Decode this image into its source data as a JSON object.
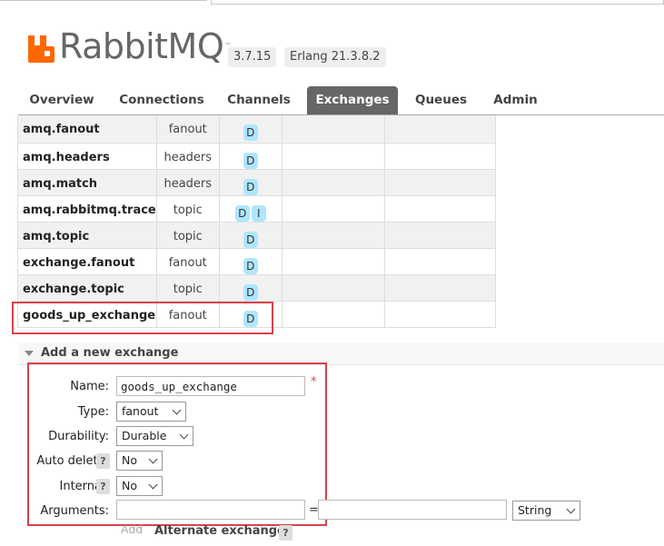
{
  "app": {
    "logo_text": "RabbitMQ",
    "version": "3.7.15",
    "erlang": "Erlang 21.3.8.2",
    "brand_color": "#ff6600"
  },
  "tabs": [
    {
      "label": "Overview",
      "active": false
    },
    {
      "label": "Connections",
      "active": false
    },
    {
      "label": "Channels",
      "active": false
    },
    {
      "label": "Exchanges",
      "active": true
    },
    {
      "label": "Queues",
      "active": false
    },
    {
      "label": "Admin",
      "active": false
    }
  ],
  "exchanges": {
    "rows": [
      {
        "name": "amq.fanout",
        "type": "fanout",
        "features": [
          "D"
        ]
      },
      {
        "name": "amq.headers",
        "type": "headers",
        "features": [
          "D"
        ]
      },
      {
        "name": "amq.match",
        "type": "headers",
        "features": [
          "D"
        ]
      },
      {
        "name": "amq.rabbitmq.trace",
        "type": "topic",
        "features": [
          "D",
          "I"
        ]
      },
      {
        "name": "amq.topic",
        "type": "topic",
        "features": [
          "D"
        ]
      },
      {
        "name": "exchange.fanout",
        "type": "fanout",
        "features": [
          "D"
        ]
      },
      {
        "name": "exchange.topic",
        "type": "topic",
        "features": [
          "D"
        ]
      },
      {
        "name": "goods_up_exchange",
        "type": "fanout",
        "features": [
          "D"
        ]
      }
    ]
  },
  "add_exchange": {
    "title": "Add a new exchange",
    "name_label": "Name:",
    "name_value": "goods_up_exchange",
    "required_mark": "*",
    "type_label": "Type:",
    "type_value": "fanout",
    "durability_label": "Durability:",
    "durability_value": "Durable",
    "auto_delete_label": "Auto delete:",
    "auto_delete_value": "No",
    "internal_label": "Internal:",
    "internal_value": "No",
    "arguments_label": "Arguments:",
    "arguments_key": "",
    "arguments_value": "",
    "equals": "=",
    "arguments_type": "String",
    "help_mark": "?",
    "add_link": "Add",
    "alternate_exchange_label": "Alternate exchange"
  }
}
